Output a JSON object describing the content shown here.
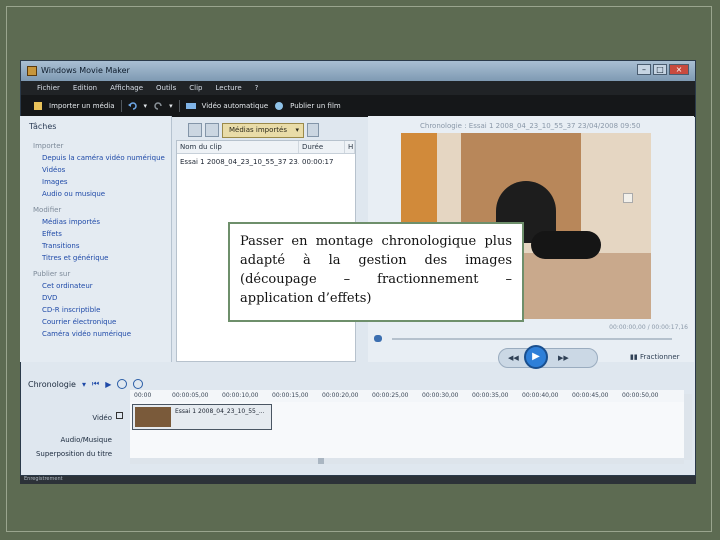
{
  "window": {
    "title": "Windows Movie Maker",
    "buttons": [
      "–",
      "□",
      "×"
    ]
  },
  "menu": [
    "Fichier",
    "Edition",
    "Affichage",
    "Outils",
    "Clip",
    "Lecture",
    "?"
  ],
  "toolbar": {
    "import": "Importer un média",
    "auto_movie": "Vidéo automatique",
    "publish": "Publier un film"
  },
  "tasks": {
    "title": "Tâches",
    "sections": [
      {
        "heading": "Importer",
        "links": [
          "Depuis la caméra vidéo numérique",
          "Vidéos",
          "Images",
          "Audio ou musique"
        ]
      },
      {
        "heading": "Modifier",
        "links": [
          "Médias importés",
          "Effets",
          "Transitions",
          "Titres et générique"
        ]
      },
      {
        "heading": "Publier sur",
        "links": [
          "Cet ordinateur",
          "DVD",
          "CD-R inscriptible",
          "Courrier électronique",
          "Caméra vidéo numérique"
        ]
      }
    ]
  },
  "media": {
    "selector": "Médias importés",
    "columns": [
      "Nom du clip",
      "Durée",
      "H"
    ],
    "rows": [
      {
        "name": "Essai 1 2008_04_23_10_55_37 23...",
        "duration": "00:00:17"
      }
    ]
  },
  "preview": {
    "title": "Chronologie : Essai 1 2008_04_23_10_55_37 23/04/2008 09:50",
    "time": "00:00:00,00 / 00:00:17,16",
    "split": "Fractionner"
  },
  "timeline": {
    "label": "Chronologie",
    "ticks": [
      "00:00",
      "00:00:05,00",
      "00:00:10,00",
      "00:00:15,00",
      "00:00:20,00",
      "00:00:25,00",
      "00:00:30,00",
      "00:00:35,00",
      "00:00:40,00",
      "00:00:45,00",
      "00:00:50,00"
    ],
    "tracks": {
      "video": "Vidéo",
      "audio": "Audio/Musique",
      "overlay": "Superposition du titre"
    },
    "clip_name": "Essai 1 2008_04_23_10_55_..."
  },
  "status": "Enregistrement",
  "callout": "Passer en montage chronologique plus adapté à la gestion des images (découpage – fractionnement – application d’effets)"
}
